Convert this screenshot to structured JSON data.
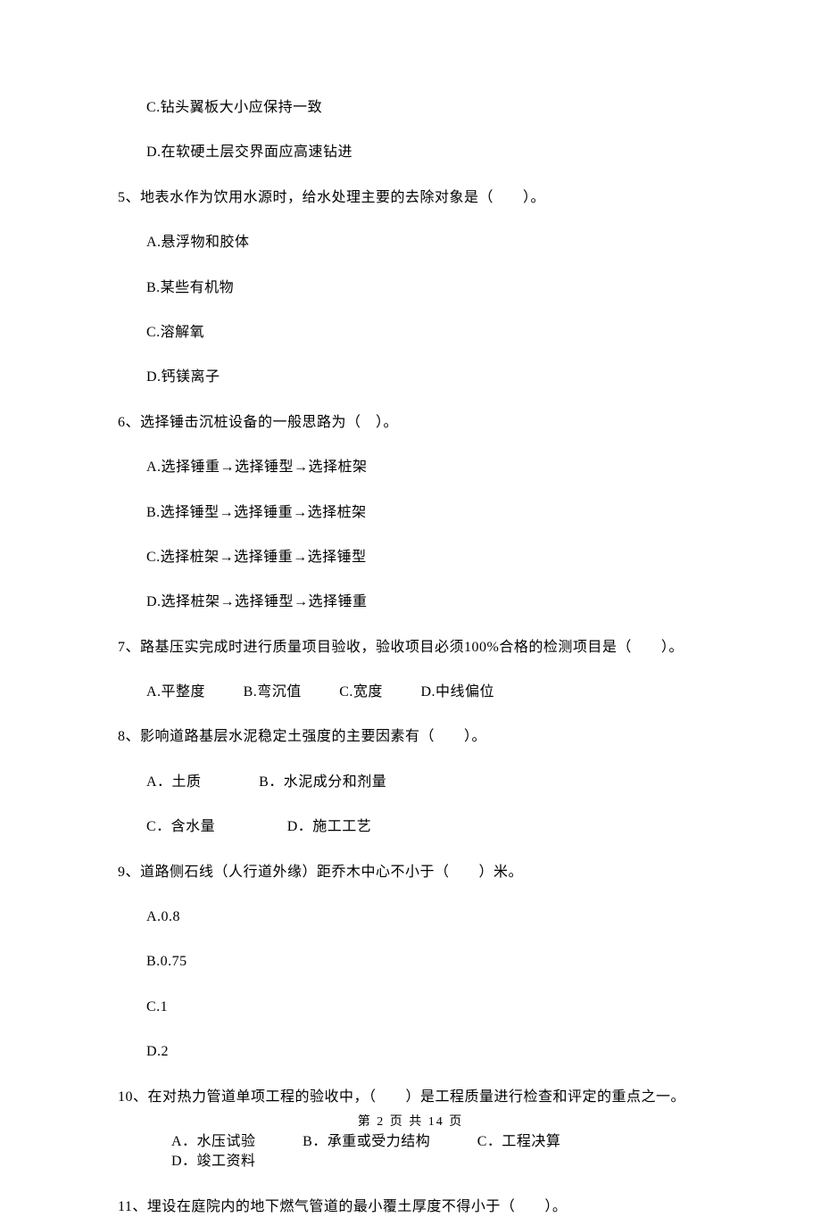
{
  "q4": {
    "optC": "C.钻头翼板大小应保持一致",
    "optD": "D.在软硬土层交界面应高速钻进"
  },
  "q5": {
    "stem": "5、地表水作为饮用水源时，给水处理主要的去除对象是（　　）。",
    "optA": "A.悬浮物和胶体",
    "optB": "B.某些有机物",
    "optC": "C.溶解氧",
    "optD": "D.钙镁离子"
  },
  "q6": {
    "stem": "6、选择锤击沉桩设备的一般思路为（　）。",
    "optA": "A.选择锤重→选择锤型→选择桩架",
    "optB": "B.选择锤型→选择锤重→选择桩架",
    "optC": "C.选择桩架→选择锤重→选择锤型",
    "optD": "D.选择桩架→选择锤型→选择锤重"
  },
  "q7": {
    "stem": "7、路基压实完成时进行质量项目验收，验收项目必须100%合格的检测项目是（　　）。",
    "optA": "A.平整度",
    "optB": "B.弯沉值",
    "optC": "C.宽度",
    "optD": "D.中线偏位"
  },
  "q8": {
    "stem": "8、影响道路基层水泥稳定土强度的主要因素有（　　）。",
    "optA": "A．土质",
    "optB": "B．水泥成分和剂量",
    "optC": "C．含水量",
    "optD": "D．施工工艺"
  },
  "q9": {
    "stem": "9、道路侧石线（人行道外缘）距乔木中心不小于（　　）米。",
    "optA": "A.0.8",
    "optB": "B.0.75",
    "optC": "C.1",
    "optD": "D.2"
  },
  "q10": {
    "stem": "10、在对热力管道单项工程的验收中，（　　）是工程质量进行检查和评定的重点之一。",
    "optA": "A．水压试验",
    "optB": "B．承重或受力结构",
    "optC": "C．工程决算",
    "optD": "D．竣工资料"
  },
  "q11": {
    "stem": "11、埋设在庭院内的地下燃气管道的最小覆土厚度不得小于（　　）。"
  },
  "footer": "第 2 页 共 14 页"
}
